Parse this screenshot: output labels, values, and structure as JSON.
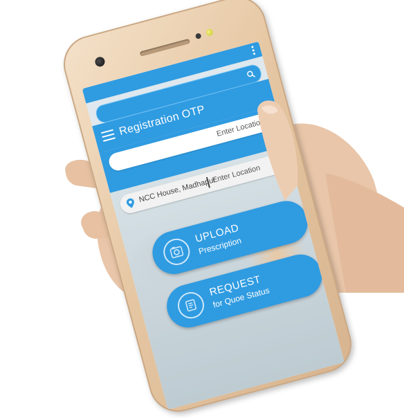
{
  "app": {
    "title": "Registration OTP"
  },
  "search": {
    "icon": "search-icon"
  },
  "location": {
    "name": "NCC House, Madhapur",
    "placeholder": "Enter Location",
    "icon": "location-pin-icon"
  },
  "actions": [
    {
      "title": "UPLOAD",
      "subtitle": "Prescription",
      "icon": "camera-icon"
    },
    {
      "title": "REQUEST",
      "subtitle": "for Quoe Status",
      "icon": "document-icon"
    }
  ],
  "colors": {
    "primary": "#2f9be1",
    "phone_gold": "#e6c7a3",
    "skin": "#e9c6a9"
  }
}
